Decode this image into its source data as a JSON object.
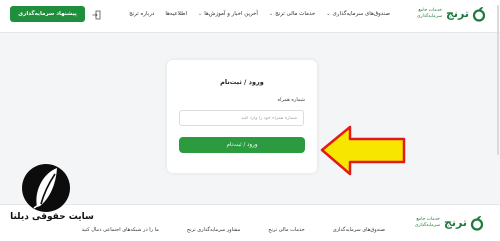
{
  "header": {
    "logo_name": "ترنج",
    "logo_tagline": "خدمات جامع سرمایه‌گذاری",
    "nav": [
      {
        "label": "صندوق‌های سرمایه‌گذاری",
        "dropdown": true
      },
      {
        "label": "خدمات مالی ترنج",
        "dropdown": true
      },
      {
        "label": "آخرین اخبار و آموزش‌ها",
        "dropdown": true
      },
      {
        "label": "اطلاعیه‌ها",
        "dropdown": false
      },
      {
        "label": "درباره ترنج",
        "dropdown": false
      }
    ],
    "login_icon": "login-arrow-icon",
    "cta_label": "پیشنهاد سرمایه‌گذاری"
  },
  "login_card": {
    "title": "ورود / ثبت‌نام",
    "phone_label": "شماره همراه",
    "phone_placeholder": "شماره همراه خود را وارد کنید",
    "phone_value": "",
    "submit_label": "ورود / ثبت‌نام"
  },
  "footer": {
    "logo_name": "ترنج",
    "logo_tagline": "خدمات جامع سرمایه‌گذاری",
    "links": [
      "صندوق‌های سرمایه‌گذاری",
      "خدمات مالی ترنج",
      "مشاور سرمایه‌گذاری ترنج",
      "ما را در شبکه‌های اجتماعی دنبال کنید"
    ]
  },
  "watermark": {
    "text": "سایت حقوقی دیلنا",
    "icon": "feather-logo-icon"
  },
  "annotation": {
    "arrow_icon": "yellow-arrow-left-icon",
    "arrow_color": "#f7e600",
    "arrow_outline": "#e11b1b"
  },
  "colors": {
    "brand_green": "#1f8e3d",
    "button_green": "#2c9a3f"
  }
}
